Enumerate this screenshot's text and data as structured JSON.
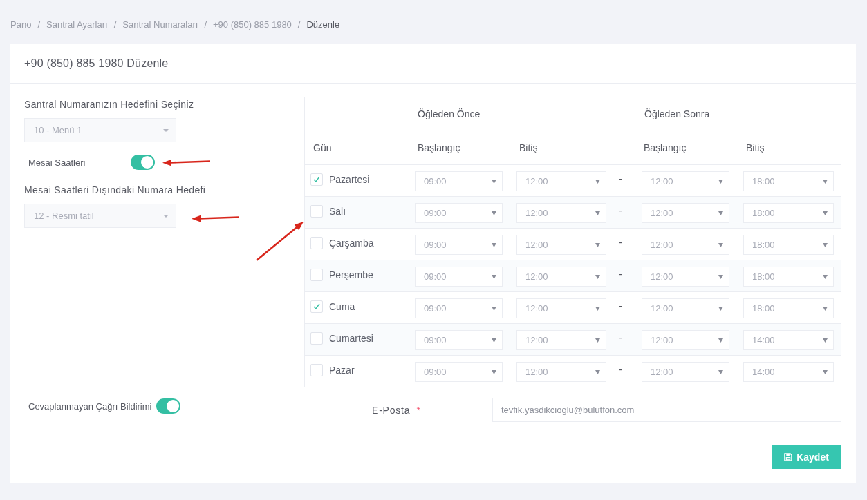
{
  "breadcrumb": [
    {
      "label": "Pano",
      "current": false,
      "separator": "/"
    },
    {
      "label": "Santral Ayarları",
      "current": false,
      "separator": "/"
    },
    {
      "label": "Santral Numaraları",
      "current": false,
      "separator": "/"
    },
    {
      "label": "+90 (850) 885 1980",
      "current": false,
      "separator": "/"
    },
    {
      "label": "Düzenle",
      "current": true
    }
  ],
  "card": {
    "title": "+90 (850) 885 1980 Düzenle"
  },
  "target_select": {
    "label": "Santral Numaranızın Hedefini Seçiniz",
    "value": "10 - Menü 1"
  },
  "working_hours_toggle": {
    "label": "Mesai Saatleri",
    "on": true,
    "annotated": true
  },
  "after_hours_select": {
    "label": "Mesai Saatleri Dışındaki Numara Hedefi",
    "value": "12 - Resmi tatil",
    "annotated": true
  },
  "schedule": {
    "annotated": true,
    "groups": [
      "Öğleden Önce",
      "Öğleden Sonra"
    ],
    "columns": [
      "Gün",
      "Başlangıç",
      "Bitiş",
      "Başlangıç",
      "Bitiş"
    ],
    "rows": [
      {
        "day": "Pazartesi",
        "checked": true,
        "morning_start": "09:00",
        "morning_end": "12:00",
        "separator": "-",
        "afternoon_start": "12:00",
        "afternoon_end": "18:00"
      },
      {
        "day": "Salı",
        "checked": false,
        "morning_start": "09:00",
        "morning_end": "12:00",
        "separator": "-",
        "afternoon_start": "12:00",
        "afternoon_end": "18:00"
      },
      {
        "day": "Çarşamba",
        "checked": false,
        "morning_start": "09:00",
        "morning_end": "12:00",
        "separator": "-",
        "afternoon_start": "12:00",
        "afternoon_end": "18:00"
      },
      {
        "day": "Perşembe",
        "checked": false,
        "morning_start": "09:00",
        "morning_end": "12:00",
        "separator": "-",
        "afternoon_start": "12:00",
        "afternoon_end": "18:00"
      },
      {
        "day": "Cuma",
        "checked": true,
        "morning_start": "09:00",
        "morning_end": "12:00",
        "separator": "-",
        "afternoon_start": "12:00",
        "afternoon_end": "18:00"
      },
      {
        "day": "Cumartesi",
        "checked": false,
        "morning_start": "09:00",
        "morning_end": "12:00",
        "separator": "-",
        "afternoon_start": "12:00",
        "afternoon_end": "14:00"
      },
      {
        "day": "Pazar",
        "checked": false,
        "morning_start": "09:00",
        "morning_end": "12:00",
        "separator": "-",
        "afternoon_start": "12:00",
        "afternoon_end": "14:00"
      }
    ]
  },
  "missed_call_toggle": {
    "label": "Cevaplanmayan Çağrı Bildirimi",
    "on": true
  },
  "email": {
    "label": "E-Posta",
    "required_mark": "*",
    "value": "tevfik.yasdikcioglu@bulutfon.com"
  },
  "save_button": {
    "label": "Kaydet"
  }
}
